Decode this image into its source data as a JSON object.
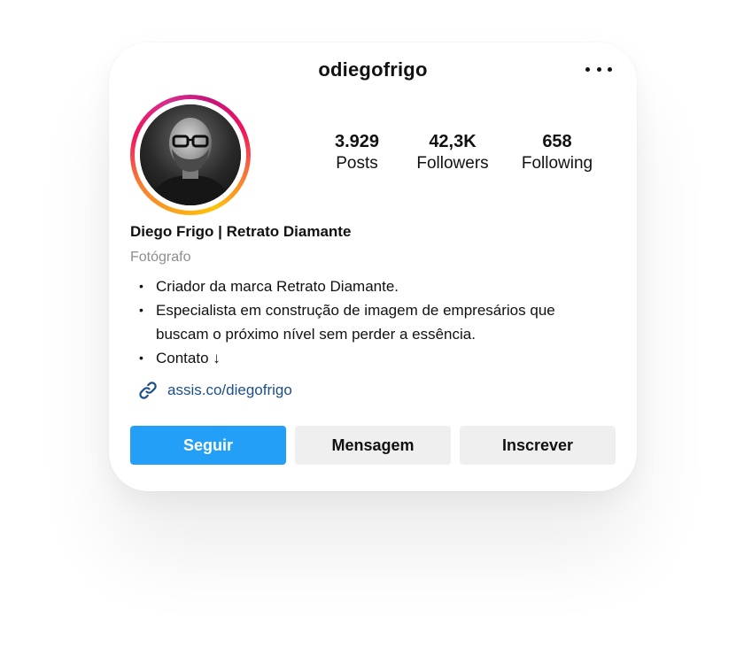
{
  "profile": {
    "username": "odiegofrigo",
    "full_name": "Diego Frigo | Retrato Diamante",
    "category": "Fotógrafo",
    "bio": [
      "Criador da marca Retrato Diamante.",
      "Especialista em construção de imagem de empresários que buscam o próximo nível sem perder a essência.",
      "Contato ↓"
    ],
    "link": "assis.co/diegofrigo"
  },
  "stats": [
    {
      "value": "3.929",
      "label": "Posts"
    },
    {
      "value": "42,3K",
      "label": "Followers"
    },
    {
      "value": "658",
      "label": "Following"
    }
  ],
  "actions": {
    "follow_label": "Seguir",
    "message_label": "Mensagem",
    "subscribe_label": "Inscrever"
  },
  "icons": {
    "more": "more-options-icon",
    "link": "link-icon"
  },
  "colors": {
    "primary_button": "#239ff7",
    "secondary_button": "#efefef",
    "link": "#1c4f87",
    "category": "#8e8e8e"
  }
}
